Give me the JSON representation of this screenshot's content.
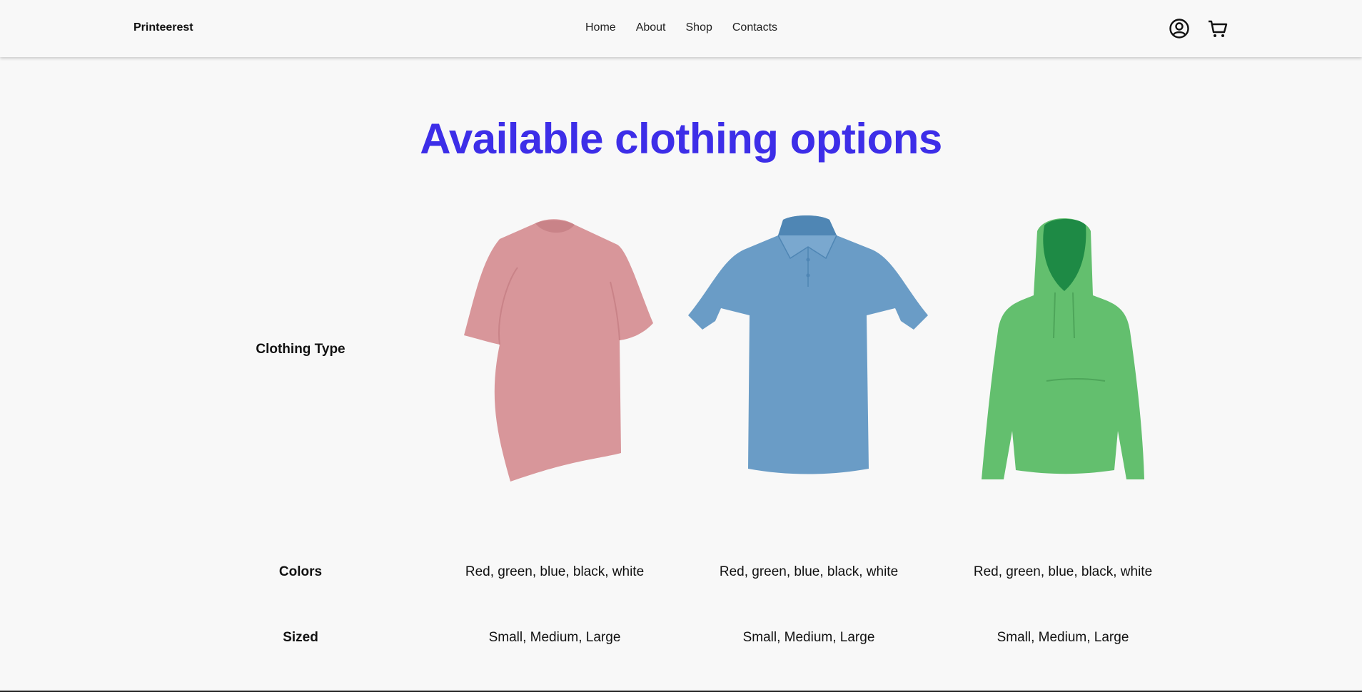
{
  "header": {
    "brand": "Printeerest",
    "nav": [
      "Home",
      "About",
      "Shop",
      "Contacts"
    ],
    "icons": [
      "user-account-icon",
      "shopping-cart-icon"
    ]
  },
  "main": {
    "title": "Available clothing options",
    "rows": {
      "clothing_type_label": "Clothing Type",
      "colors_label": "Colors",
      "sizes_label": "Sized"
    },
    "products": [
      {
        "garment": "t-shirt",
        "color": "#d8969a",
        "colors": "Red, green, blue, black, white",
        "sizes": "Small, Medium, Large"
      },
      {
        "garment": "polo-shirt",
        "color": "#6a9cc6",
        "colors": "Red, green, blue, black, white",
        "sizes": "Small, Medium, Large"
      },
      {
        "garment": "hoodie",
        "color": "#63bf6e",
        "colors": "Red, green, blue, black, white",
        "sizes": "Small, Medium, Large"
      }
    ]
  },
  "colors": {
    "accent": "#3d2ee8",
    "background": "#f8f8f8"
  }
}
